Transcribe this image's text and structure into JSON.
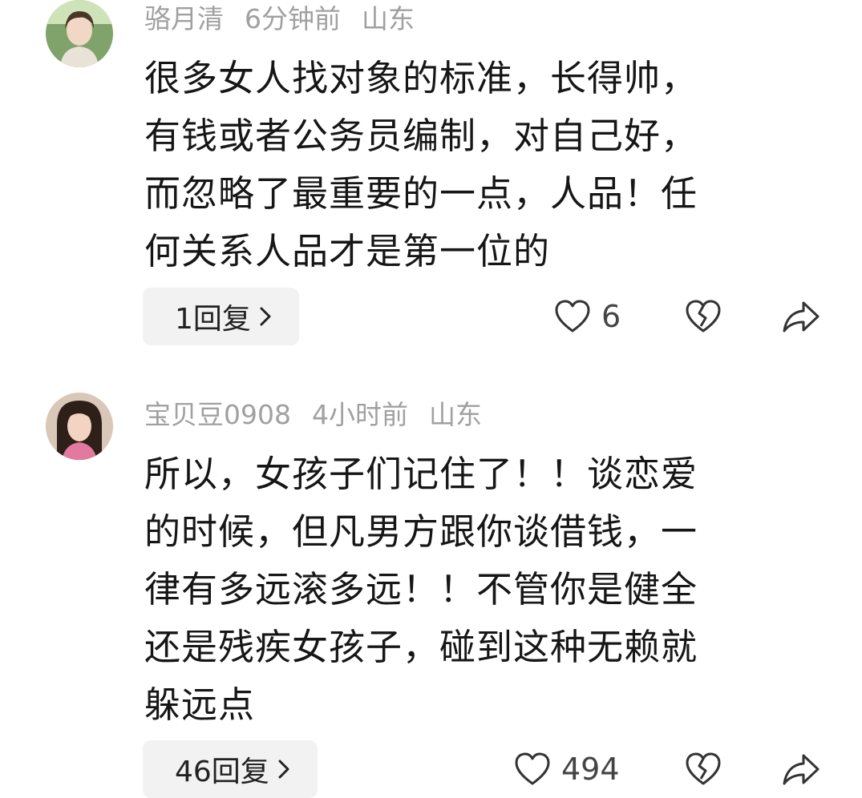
{
  "comments": [
    {
      "username": "骆月清",
      "time": "6分钟前",
      "location": "山东",
      "lines": [
        "很多女人找对象的标准，长得帅，",
        "有钱或者公务员编制，对自己好，",
        "而忽略了最重要的一点，人品！任",
        "何关系人品才是第一位的"
      ],
      "replies_label": "1回复",
      "like_count": "6",
      "icons": {
        "like": "heart-outline-icon",
        "dislike": "broken-heart-icon",
        "share": "share-arrow-icon",
        "chevron": "chevron-right-icon"
      }
    },
    {
      "username": "宝贝豆0908",
      "time": "4小时前",
      "location": "山东",
      "lines": [
        "所以，女孩子们记住了！！谈恋爱",
        "的时候，但凡男方跟你谈借钱，一",
        "律有多远滚多远！！不管你是健全",
        "还是残疾女孩子，碰到这种无赖就",
        "躲远点"
      ],
      "replies_label": "46回复",
      "like_count": "494",
      "icons": {
        "like": "heart-outline-icon",
        "dislike": "broken-heart-icon",
        "share": "share-arrow-icon",
        "chevron": "chevron-right-icon"
      }
    }
  ],
  "colors": {
    "meta_text": "#a0a0a0",
    "body_text": "#161616",
    "reply_button_bg": "#f2f2f2",
    "icon_stroke": "#333333"
  }
}
